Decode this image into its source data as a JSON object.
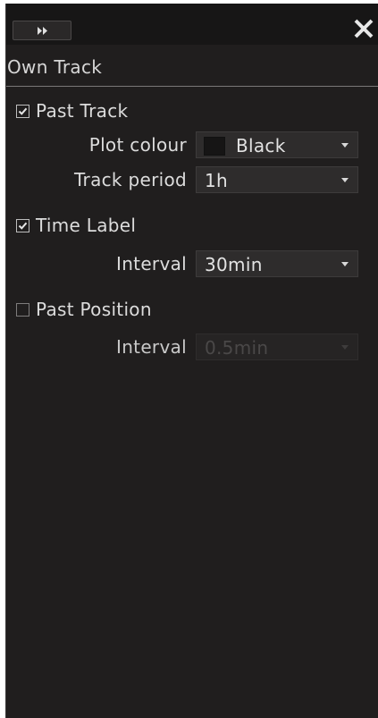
{
  "panel": {
    "title": "Own Track"
  },
  "past_track": {
    "label": "Past Track",
    "checked": true,
    "plot_colour_label": "Plot colour",
    "plot_colour_value": "Black",
    "plot_colour_swatch": "#161515",
    "track_period_label": "Track period",
    "track_period_value": "1h"
  },
  "time_label": {
    "label": "Time Label",
    "checked": true,
    "interval_label": "Interval",
    "interval_value": "30min"
  },
  "past_position": {
    "label": "Past Position",
    "checked": false,
    "interval_label": "Interval",
    "interval_value": "0.5min",
    "interval_enabled": false
  },
  "colors": {
    "panel_bg": "#201e1e",
    "text": "#dcdcdc",
    "dropdown_bg": "#2e2c2c"
  },
  "icons": {
    "expand": "double-chevron-right-icon",
    "close": "close-icon",
    "check": "checkmark-icon",
    "caret": "caret-down-icon"
  }
}
